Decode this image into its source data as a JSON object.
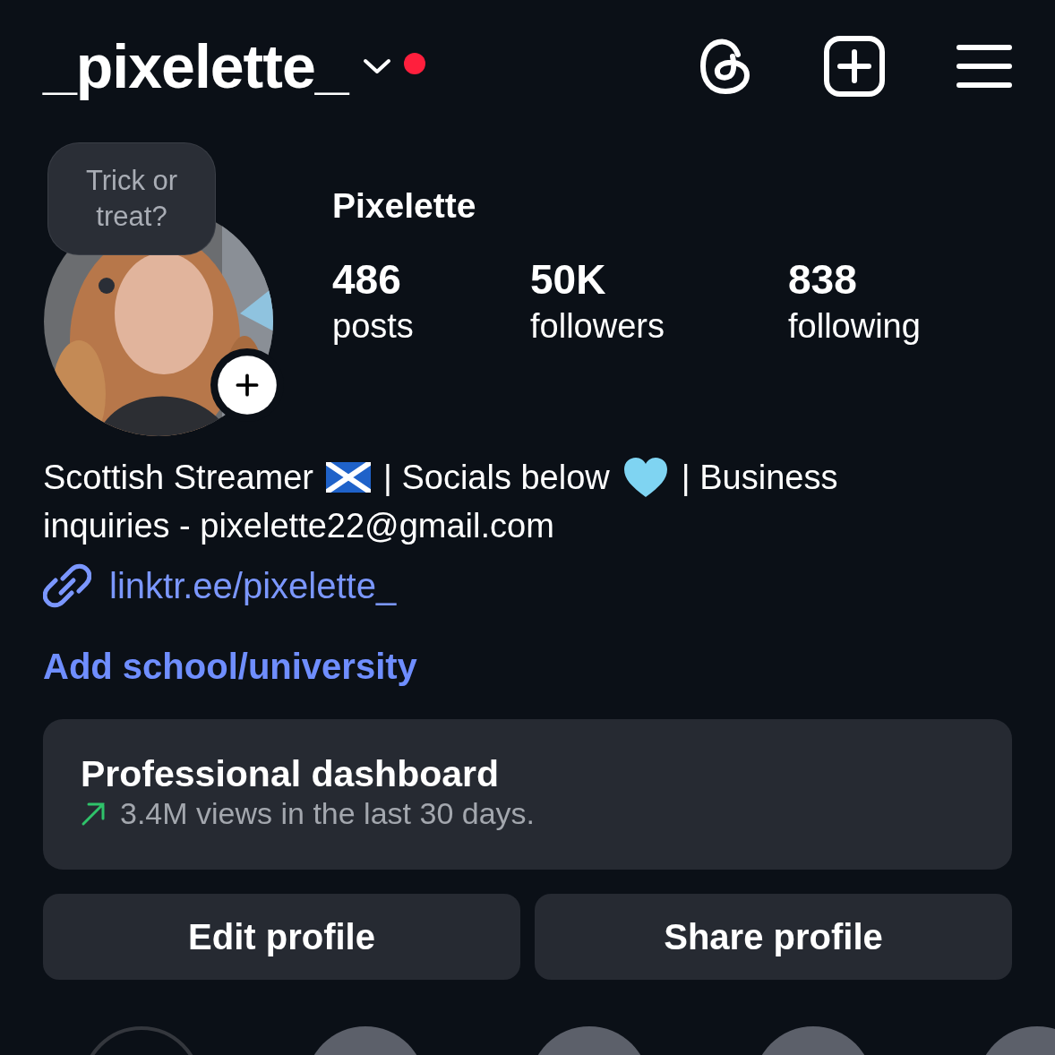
{
  "header": {
    "username": "_pixelette_",
    "has_notification": true
  },
  "note": {
    "text": "Trick or treat?"
  },
  "avatar": {
    "kind": "picture"
  },
  "profile": {
    "name": "Pixelette"
  },
  "stats": [
    {
      "value": "486",
      "label": "posts"
    },
    {
      "value": "50K",
      "label": "followers"
    },
    {
      "value": "838",
      "label": "following"
    }
  ],
  "bio": [
    "Scottish Streamer",
    "| Socials below",
    "| Business",
    "inquiries - pixelette22@gmail.com"
  ],
  "link": "linktr.ee/pixelette_",
  "add_school": "Add school/university",
  "dashboard": {
    "title": "Professional dashboard",
    "subtitle": "3.4M views in the last 30 days."
  },
  "buttons": [
    "Edit profile",
    "Share profile"
  ],
  "highlights": [
    {
      "kind": "new"
    },
    {
      "kind": "story"
    },
    {
      "kind": "story"
    },
    {
      "kind": "story"
    },
    {
      "kind": "story"
    }
  ]
}
